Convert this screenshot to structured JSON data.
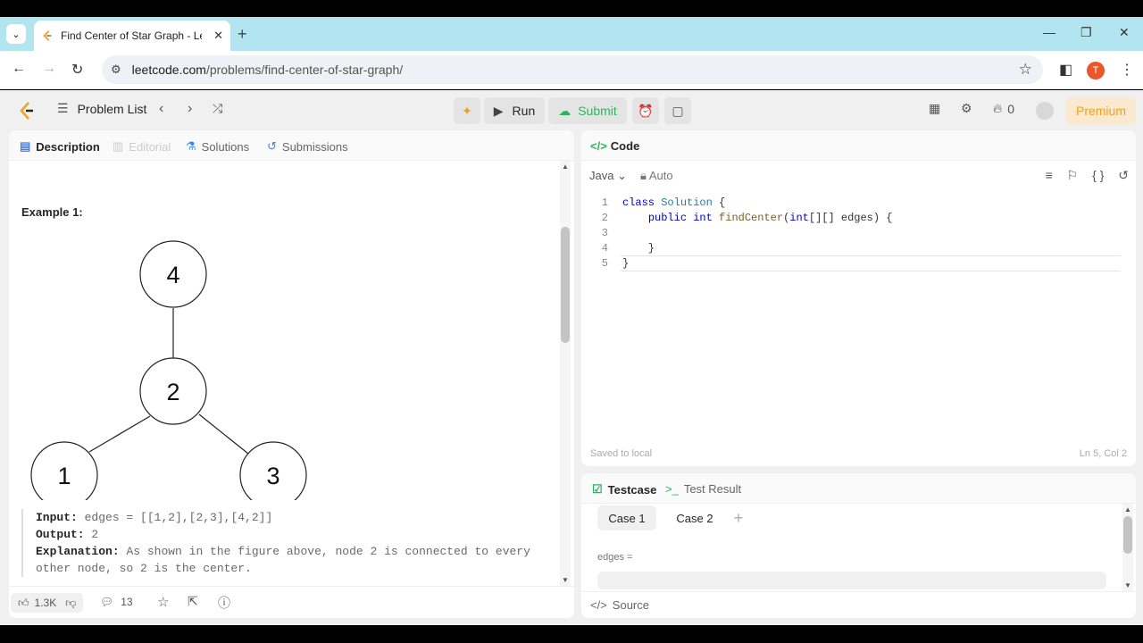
{
  "browser": {
    "tab_title": "Find Center of Star Graph - Lee",
    "url_host": "leetcode.com",
    "url_path": "/problems/find-center-of-star-graph/",
    "profile_initial": "T"
  },
  "nav": {
    "problem_list": "Problem List",
    "run": "Run",
    "submit": "Submit",
    "streak": "0",
    "premium": "Premium"
  },
  "description": {
    "tabs": [
      "Description",
      "Editorial",
      "Solutions",
      "Submissions"
    ],
    "example_title": "Example 1:",
    "graph_nodes": [
      "4",
      "2",
      "1",
      "3"
    ],
    "input_label": "Input:",
    "input_value": "edges = [[1,2],[2,3],[4,2]]",
    "output_label": "Output:",
    "output_value": "2",
    "explanation_label": "Explanation:",
    "explanation_value": "As shown in the figure above, node 2 is connected to every",
    "explanation_value_2": "other node, so 2 is the center.",
    "likes": "1.3K",
    "comments": "13"
  },
  "code": {
    "title": "Code",
    "language": "Java",
    "mode": "Auto",
    "line_numbers": [
      "1",
      "2",
      "3",
      "4",
      "5"
    ],
    "saved": "Saved to local",
    "cursor": "Ln 5, Col 2"
  },
  "testcase": {
    "tabs": [
      "Testcase",
      "Test Result"
    ],
    "cases": [
      "Case 1",
      "Case 2"
    ],
    "edges_label": "edges =",
    "source": "Source"
  },
  "colors": {
    "run_submit_green": "#2db55d",
    "premium_orange": "#f0a020",
    "tab_strip": "#b3e5f0"
  }
}
